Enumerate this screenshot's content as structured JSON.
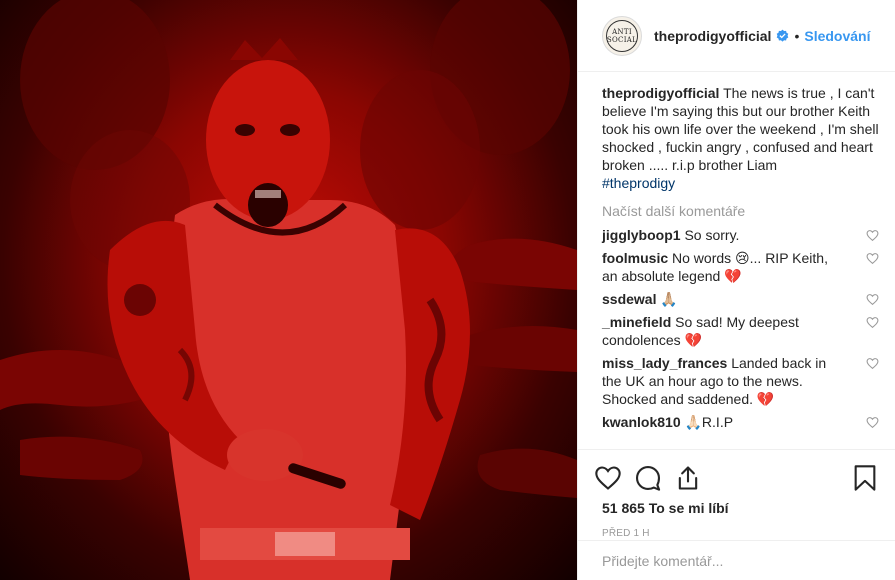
{
  "post": {
    "username": "theprodigyofficial",
    "follow_label": "Sledování",
    "avatar_text": [
      "ANTI",
      "SOCIAL"
    ],
    "caption": "The news is true , I can't believe I'm saying this but our brother Keith took his own life over the weekend , I'm shell shocked , fuckin angry , confused and heart broken ..... r.i.p brother Liam",
    "hashtag": "#theprodigy",
    "load_more": "Načíst další komentáře",
    "comments": [
      {
        "user": "jigglyboop1",
        "text": "So sorry."
      },
      {
        "user": "foolmusic",
        "text": "No words 😢... RIP Keith, an absolute legend 💔"
      },
      {
        "user": "ssdewal",
        "text": "🙏🏼"
      },
      {
        "user": "_minefield",
        "text": "So sad! My deepest condolences 💔"
      },
      {
        "user": "miss_lady_frances",
        "text": "Landed back in the UK an hour ago to the news. Shocked and saddened. 💔"
      },
      {
        "user": "kwanlok810",
        "text": "🙏🏻R.I.P"
      }
    ],
    "likes": "51 865 To se mi líbí",
    "time": "PŘED 1 H",
    "add_comment_placeholder": "Přidejte komentář..."
  },
  "colors": {
    "link": "#3897f0",
    "hashtag": "#003569",
    "muted": "#999999",
    "photo_red": "#c40c06"
  },
  "icons": [
    "verified-badge-icon",
    "heart-icon",
    "comment-icon",
    "share-icon",
    "bookmark-icon",
    "small-heart-icon"
  ]
}
